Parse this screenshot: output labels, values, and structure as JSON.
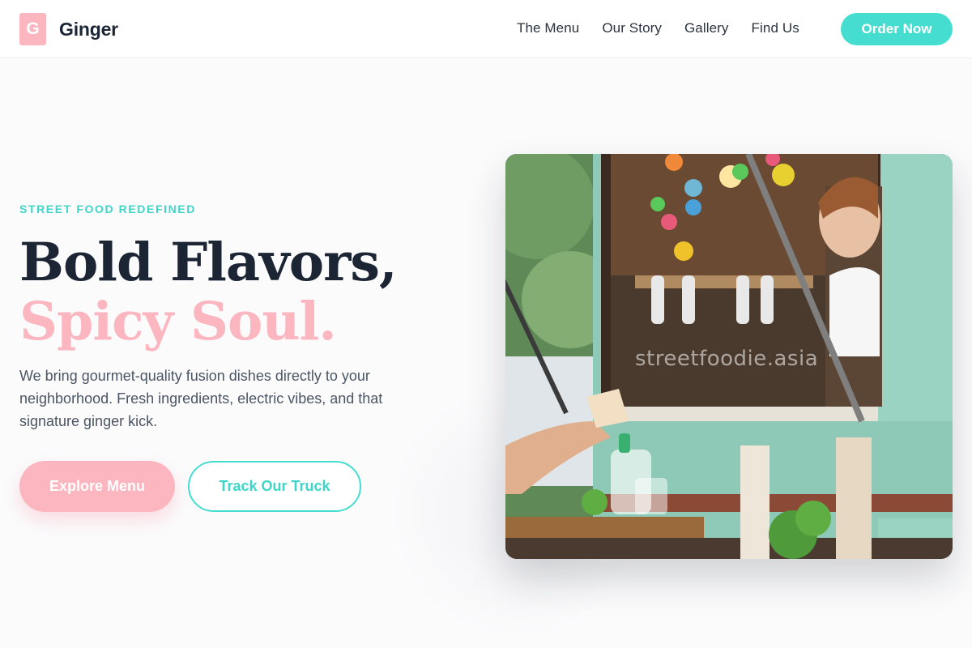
{
  "brand": {
    "mark": "G",
    "name": "Ginger"
  },
  "nav": {
    "links": [
      "The Menu",
      "Our Story",
      "Gallery",
      "Find Us"
    ],
    "cta_label": "Order Now"
  },
  "hero": {
    "eyebrow": "STREET FOOD REDEFINED",
    "headline_line1": "Bold Flavors,",
    "headline_line2": "Spicy Soul.",
    "lead": "We bring gourmet-quality fusion dishes directly to your neighborhood. Fresh ingredients, electric vibes, and that signature ginger kick.",
    "primary_button": "Explore Menu",
    "secondary_button": "Track Our Truck",
    "image_watermark": "streetfoodie.asia"
  },
  "colors": {
    "accent_pink": "#fbb6c0",
    "accent_teal": "#45ddd0",
    "ink": "#1b2533"
  }
}
